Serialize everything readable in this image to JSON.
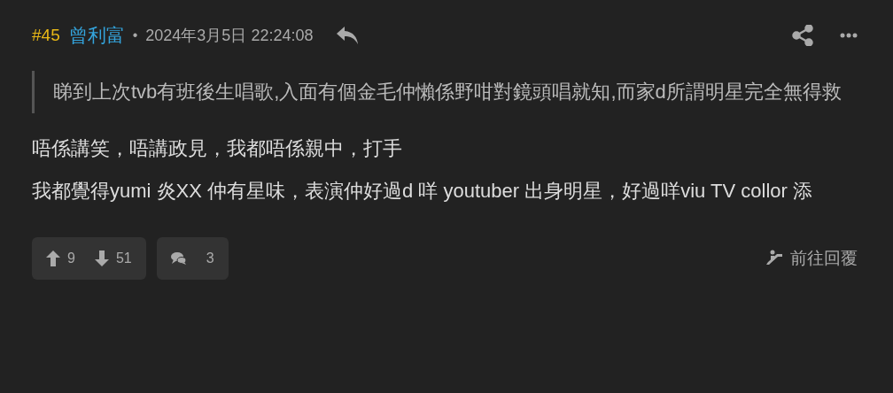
{
  "post": {
    "number": "#45",
    "author": "曾利富",
    "separator": "•",
    "timestamp": "2024年3月5日 22:24:08",
    "quote": "睇到上次tvb有班後生唱歌,入面有個金毛仲懶係野咁對鏡頭唱就知,而家d所謂明星完全無得救",
    "body": [
      "唔係講笑，唔講政見，我都唔係親中，打手",
      "我都覺得yumi 炎XX 仲有星味，表演仲好過d 咩 youtuber 出身明星，好過咩viu TV collor 添"
    ],
    "upvotes": "9",
    "downvotes": "51",
    "replies": "3",
    "goto_reply": "前往回覆"
  }
}
